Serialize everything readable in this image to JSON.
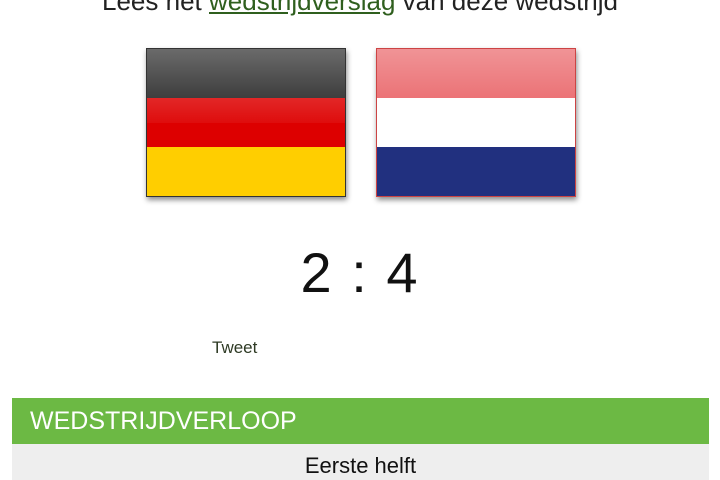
{
  "report": {
    "prefix": "Lees het",
    "link": "wedstrijdverslag",
    "suffix": "van deze wedstrijd"
  },
  "flags": {
    "home": {
      "country_icon": "germany-flag-icon",
      "colors": [
        "#1b1b1b",
        "#dd0000",
        "#ffce00"
      ]
    },
    "away": {
      "country_icon": "netherlands-flag-icon",
      "colors": [
        "#e85a5e",
        "#ffffff",
        "#21307f"
      ]
    }
  },
  "score": {
    "home": "2",
    "separator": ":",
    "away": "4"
  },
  "social": {
    "tweet_label": "Tweet"
  },
  "section": {
    "title": "WEDSTRIJDVERLOOP",
    "accent_color": "#6cb944"
  },
  "timeline": {
    "first_half_label": "Eerste helft"
  }
}
